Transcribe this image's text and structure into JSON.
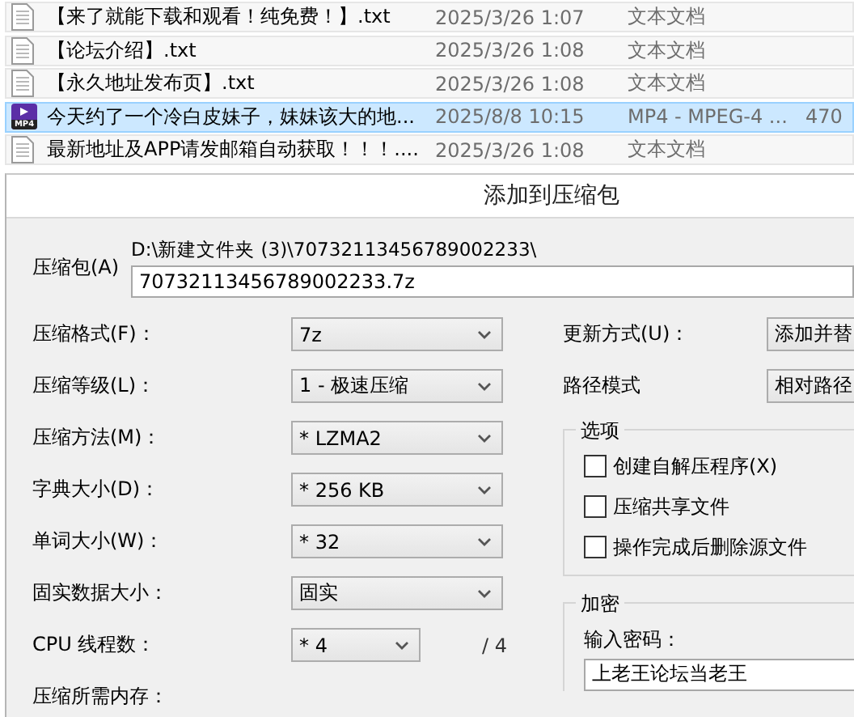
{
  "files": [
    {
      "kind": "text",
      "name": "【来了就能下载和观看！纯免费！】.txt",
      "date": "2025/3/26 1:07",
      "type": "文本文档",
      "selected": false
    },
    {
      "kind": "text",
      "name": "【论坛介绍】.txt",
      "date": "2025/3/26 1:08",
      "type": "文本文档",
      "selected": false
    },
    {
      "kind": "text",
      "name": "【永久地址发布页】.txt",
      "date": "2025/3/26 1:08",
      "type": "文本文档",
      "selected": false
    },
    {
      "kind": "video",
      "badge": "MP4",
      "name": "今天约了一个冷白皮妹子，妹妹该大的地...",
      "date": "2025/8/8 10:15",
      "type": "MP4 - MPEG-4 ...",
      "size": "470",
      "selected": true
    },
    {
      "kind": "text",
      "name": "最新地址及APP请发邮箱自动获取！！！....",
      "date": "2025/3/26 1:08",
      "type": "文本文档",
      "selected": false
    }
  ],
  "dialog": {
    "title": "添加到压缩包",
    "archive": {
      "label": "压缩包(A)",
      "path": "D:\\新建文件夹 (3)\\70732113456789002233\\",
      "value": "70732113456789002233.7z"
    },
    "left_fields": [
      {
        "kind": "combo",
        "label": "压缩格式(F)：",
        "value": "7z"
      },
      {
        "kind": "combo",
        "label": "压缩等级(L)：",
        "value": "1 - 极速压缩"
      },
      {
        "kind": "combo",
        "label": "压缩方法(M)：",
        "value": "* LZMA2"
      },
      {
        "kind": "combo",
        "label": "字典大小(D)：",
        "value": "* 256 KB"
      },
      {
        "kind": "combo",
        "label": "单词大小(W)：",
        "value": "* 32"
      },
      {
        "kind": "combo",
        "label": "固实数据大小：",
        "value": "固实"
      },
      {
        "kind": "short_combo",
        "label": "CPU 线程数：",
        "value": "* 4",
        "suffix": "/ 4"
      },
      {
        "kind": "label",
        "label": "压缩所需内存："
      }
    ],
    "right_fields": [
      {
        "label": "更新方式(U)：",
        "value": "添加并替"
      },
      {
        "label": "路径模式",
        "value": "相对路径"
      }
    ],
    "options": {
      "title": "选项",
      "checkboxes": [
        {
          "label": "创建自解压程序(X)",
          "checked": false
        },
        {
          "label": "压缩共享文件",
          "checked": false
        },
        {
          "label": "操作完成后删除源文件",
          "checked": false
        }
      ]
    },
    "encryption": {
      "title": "加密",
      "password_label": "输入密码：",
      "password": "上老王论坛当老王"
    }
  }
}
